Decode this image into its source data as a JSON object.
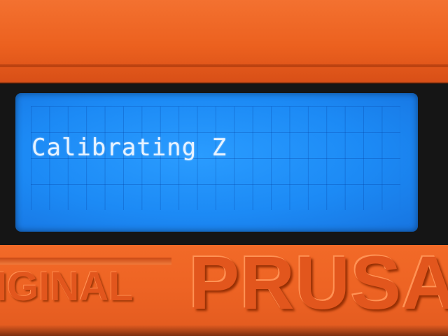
{
  "display": {
    "line1": "",
    "line2": "Calibrating Z",
    "line3": "",
    "line4": ""
  },
  "device": {
    "brand_left": "IGINAL",
    "brand_right": "PRUSA"
  },
  "colors": {
    "lcd_background": "#1c8af5",
    "lcd_text": "#e8f3ff",
    "case": "#ee6424"
  }
}
